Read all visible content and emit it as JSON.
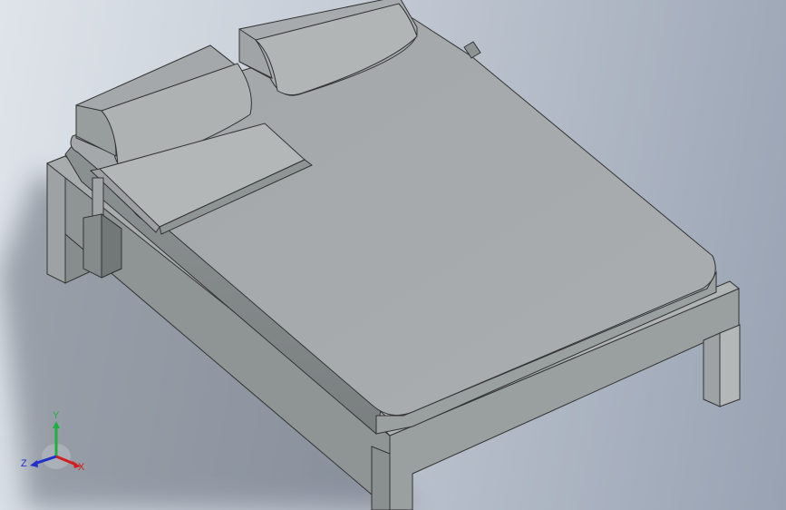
{
  "viewport": {
    "background_top": "#dfe4ea",
    "background_bottom": "#98a2b2"
  },
  "model": {
    "body_color": "#a6aaac",
    "shade_dark": "#6f7475",
    "shade_mid": "#8e9394",
    "highlight": "#b7bbbc"
  },
  "triad": {
    "x_label": "X",
    "y_label": "Y",
    "z_label": "Z",
    "x_color": "#d22020",
    "y_color": "#20b040",
    "z_color": "#2030c8"
  }
}
